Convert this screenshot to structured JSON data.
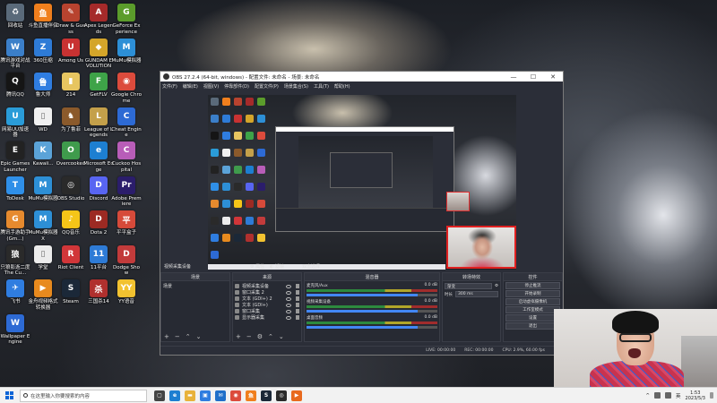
{
  "desktop_icons": [
    {
      "label": "回收站",
      "color": "#5a6a7a",
      "glyph": "♻"
    },
    {
      "label": "斗鱼直播伴侣",
      "color": "#f07f1d",
      "glyph": "鱼"
    },
    {
      "label": "Draw & Guess",
      "color": "#b8432f",
      "glyph": "✎"
    },
    {
      "label": "Apex Legends",
      "color": "#a52a2a",
      "glyph": "A"
    },
    {
      "label": "GeForce Experience",
      "color": "#5b9c2b",
      "glyph": "G"
    },
    {
      "label": "腾讯游戏对战平台",
      "color": "#3b7fc9",
      "glyph": "W"
    },
    {
      "label": "360压缩",
      "color": "#2e7bd6",
      "glyph": "Z"
    },
    {
      "label": "Among Us",
      "color": "#c83232",
      "glyph": "U"
    },
    {
      "label": "GUNDAM EVOLUTION",
      "color": "#d4a52a",
      "glyph": "◆"
    },
    {
      "label": "MuMu模拟器",
      "color": "#2d8fd6",
      "glyph": "M"
    },
    {
      "label": "腾讯QQ",
      "color": "#151515",
      "glyph": "Q"
    },
    {
      "label": "鲁大师",
      "color": "#2f7de0",
      "glyph": "鲁"
    },
    {
      "label": "214",
      "color": "#e7c560",
      "glyph": "▮"
    },
    {
      "label": "GetFLV",
      "color": "#3ea348",
      "glyph": "F"
    },
    {
      "label": "Google Chrome",
      "color": "#dc4b3c",
      "glyph": "◉"
    },
    {
      "label": "网易UU加速器",
      "color": "#2a9cd8",
      "glyph": "U"
    },
    {
      "label": "WD",
      "color": "#f0f0f0",
      "glyph": "▯"
    },
    {
      "label": "为了鲁菲",
      "color": "#8b5a2b",
      "glyph": "♞"
    },
    {
      "label": "League of Legends",
      "color": "#c4a04a",
      "glyph": "L"
    },
    {
      "label": "Cheat Engine",
      "color": "#2d6ad4",
      "glyph": "C"
    },
    {
      "label": "Epic Games Launcher",
      "color": "#222222",
      "glyph": "E"
    },
    {
      "label": "Kawaii...",
      "color": "#5ba3d8",
      "glyph": "K"
    },
    {
      "label": "Overcooked",
      "color": "#3f9b4c",
      "glyph": "O"
    },
    {
      "label": "Microsoft Edge",
      "color": "#1d7fd1",
      "glyph": "e"
    },
    {
      "label": "Cuckoo Hospital",
      "color": "#b85db8",
      "glyph": "C"
    },
    {
      "label": "ToDesk",
      "color": "#2f8fe8",
      "glyph": "T"
    },
    {
      "label": "MuMu模拟器",
      "color": "#2d8fd6",
      "glyph": "M"
    },
    {
      "label": "OBS Studio",
      "color": "#2a2a2a",
      "glyph": "◎"
    },
    {
      "label": "Discord",
      "color": "#5865f2",
      "glyph": "D"
    },
    {
      "label": "Adobe Premiere",
      "color": "#2b1d6b",
      "glyph": "Pr"
    },
    {
      "label": "腾讯手游助手(Gm...)",
      "color": "#e68a2e",
      "glyph": "G"
    },
    {
      "label": "MuMu模拟器X",
      "color": "#2d8fd6",
      "glyph": "M"
    },
    {
      "label": "QQ音乐",
      "color": "#f5c518",
      "glyph": "♪"
    },
    {
      "label": "Dota 2",
      "color": "#9c2a23",
      "glyph": "D"
    },
    {
      "label": "平平盒子",
      "color": "#d64a3a",
      "glyph": "平"
    },
    {
      "label": "只狼影逝二度 The Cu...",
      "color": "#2a2a2a",
      "glyph": "狼"
    },
    {
      "label": "学堂",
      "color": "#ececec",
      "glyph": "▯"
    },
    {
      "label": "Riot Client",
      "color": "#d13639",
      "glyph": "R"
    },
    {
      "label": "11平台",
      "color": "#2e7bd6",
      "glyph": "11"
    },
    {
      "label": "Dodge Show",
      "color": "#c23b3b",
      "glyph": "D"
    },
    {
      "label": "飞书",
      "color": "#2f7de0",
      "glyph": "✈"
    },
    {
      "label": "金舟视频格式转换器",
      "color": "#e88a1e",
      "glyph": "▶"
    },
    {
      "label": "Steam",
      "color": "#1b2838",
      "glyph": "S"
    },
    {
      "label": "三国杀14",
      "color": "#b0302e",
      "glyph": "杀"
    },
    {
      "label": "YY语音",
      "color": "#f2c230",
      "glyph": "YY"
    },
    {
      "label": "Wallpaper Engine",
      "color": "#2d6ad4",
      "glyph": "W"
    }
  ],
  "obs": {
    "title": "OBS 27.2.4 (64-bit, windows) - 配置文件: 未命名 - 场景: 未命名",
    "menu": [
      "文件(F)",
      "编辑(E)",
      "视图(V)",
      "停靠部件(D)",
      "配置文件(P)",
      "场景集合(S)",
      "工具(T)",
      "帮助(H)"
    ],
    "window_controls": [
      "—",
      "☐",
      "✕"
    ],
    "scene_bar": {
      "items": [
        "视频采集设备",
        "⚙ 属性",
        "◐ 滤镜",
        "双击选择"
      ]
    },
    "docks": {
      "scenes": {
        "header": "场景",
        "items": [
          "场景"
        ]
      },
      "sources": {
        "header": "来源",
        "items": [
          "视频采集设备",
          "窗口采集 2",
          "文本 (GDI+) 2",
          "文本 (GDI+)",
          "窗口采集",
          "显示器采集"
        ]
      },
      "mixer": {
        "header": "混音器",
        "channels": [
          {
            "name": "麦克风/Aux",
            "db": "0.0 dB"
          },
          {
            "name": "视频采集设备",
            "db": "0.0 dB"
          },
          {
            "name": "桌面音频",
            "db": "0.0 dB"
          }
        ]
      },
      "transitions": {
        "header": "转场特效",
        "type": "渐变",
        "duration_label": "时长",
        "duration": "300 ms"
      },
      "controls": {
        "header": "控件",
        "buttons": [
          "停止推流",
          "开始录制",
          "启动虚拟摄像机",
          "工作室模式",
          "设置",
          "退出"
        ]
      }
    },
    "status": {
      "live": "LIVE: 00:00:00",
      "rec": "REC: 00:00:00",
      "cpu": "CPU: 2.9%, 60.00 fps"
    }
  },
  "taskbar": {
    "search_placeholder": "在这里输入你要搜索的内容",
    "apps": [
      {
        "name": "task-view",
        "color": "#444444",
        "glyph": "▢"
      },
      {
        "name": "edge",
        "color": "#1d7fd1",
        "glyph": "e"
      },
      {
        "name": "file-explorer",
        "color": "#e8b23a",
        "glyph": "▬"
      },
      {
        "name": "store",
        "color": "#2f7de0",
        "glyph": "▣"
      },
      {
        "name": "mail",
        "color": "#1f6fc9",
        "glyph": "✉"
      },
      {
        "name": "chrome",
        "color": "#dc4b3c",
        "glyph": "◉"
      },
      {
        "name": "douyu",
        "color": "#f07f1d",
        "glyph": "鱼"
      },
      {
        "name": "steam",
        "color": "#1b2838",
        "glyph": "S"
      },
      {
        "name": "obs",
        "color": "#2a2a2a",
        "glyph": "◎"
      },
      {
        "name": "app-orange",
        "color": "#e86a1e",
        "glyph": "▶"
      }
    ],
    "tray_text": [
      "^",
      "英"
    ],
    "time": "1:53",
    "date": "2023/5/3"
  }
}
